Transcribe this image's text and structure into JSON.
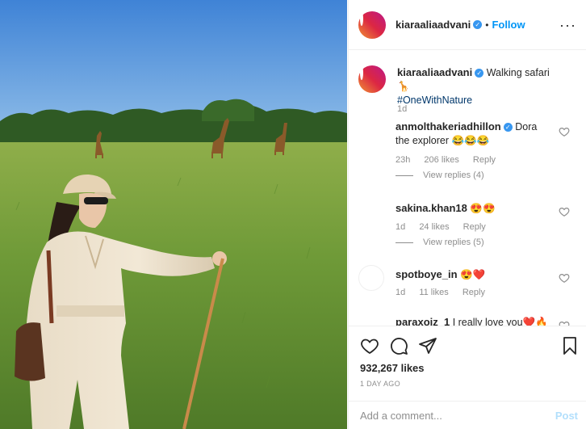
{
  "post": {
    "username": "kiaraaliaadvani",
    "follow_label": "Follow",
    "caption_text": "Walking safari 🦒",
    "caption_hashtag": "#OneWithNature",
    "caption_time": "1d"
  },
  "comments": [
    {
      "username": "anmolthakeriadhillon",
      "verified": true,
      "text": "Dora the explorer 😂😂😂",
      "time": "23h",
      "likes": "206 likes",
      "reply_label": "Reply",
      "view_replies": "View replies (4)"
    },
    {
      "username": "sakina.khan18",
      "text": "😍😍",
      "time": "1d",
      "likes": "24 likes",
      "reply_label": "Reply",
      "view_replies": "View replies (5)"
    },
    {
      "username": "spotboye_in",
      "text": "😍❤️",
      "time": "1d",
      "likes": "11 likes",
      "reply_label": "Reply"
    },
    {
      "username": "paraxoiz_1",
      "text": "I really love you❤️🔥"
    }
  ],
  "footer": {
    "likes": "932,267 likes",
    "time_ago": "1 DAY AGO",
    "comment_placeholder": "Add a comment...",
    "post_label": "Post"
  },
  "colors": {
    "accent": "#0095f6",
    "verified": "#3897f0",
    "muted": "#8e8e8e",
    "text": "#262626",
    "border": "#efefef"
  },
  "icons": [
    "verified-icon",
    "more-icon",
    "heart-icon",
    "comment-icon",
    "share-icon",
    "bookmark-icon"
  ]
}
